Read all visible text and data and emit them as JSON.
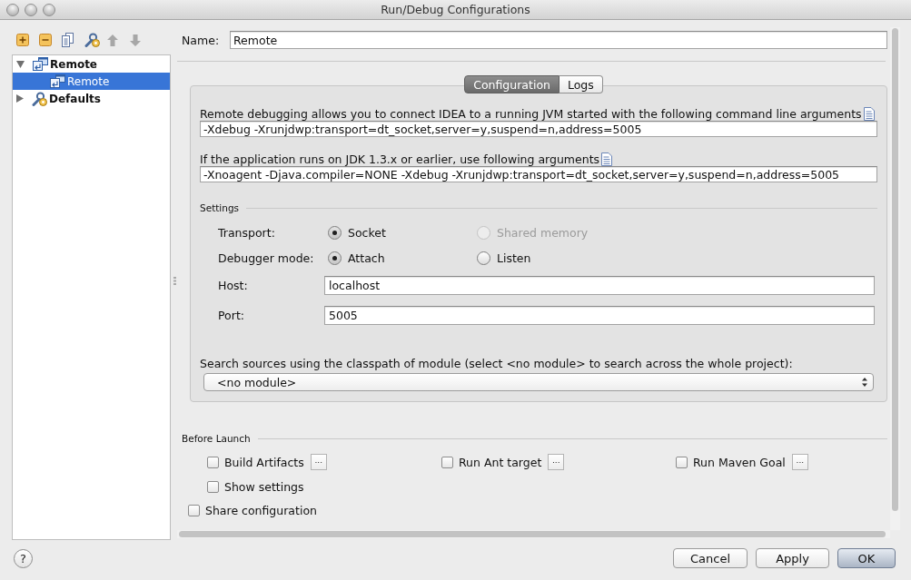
{
  "window": {
    "title": "Run/Debug Configurations"
  },
  "toolbar": [
    {
      "kind": "add",
      "disabled": false
    },
    {
      "kind": "remove",
      "disabled": false
    },
    {
      "kind": "copy",
      "disabled": false
    },
    {
      "kind": "defaults",
      "disabled": false
    },
    {
      "kind": "move-up",
      "disabled": true
    },
    {
      "kind": "move-down",
      "disabled": true
    }
  ],
  "tree": [
    {
      "kind": "remote",
      "label": "Remote",
      "expanded": true,
      "selected": false,
      "children": [
        {
          "kind": "remote",
          "label": "Remote",
          "selected": true
        }
      ]
    },
    {
      "kind": "defaults",
      "label": "Defaults",
      "expanded": false,
      "selected": false
    }
  ],
  "name_field": {
    "label": "Name:",
    "value": "Remote"
  },
  "tabs": [
    {
      "label": "Configuration",
      "selected": true
    },
    {
      "label": "Logs",
      "selected": false
    }
  ],
  "configuration": {
    "intro": "Remote debugging allows you to connect IDEA to a running JVM started with the following command line arguments",
    "command_line": "-Xdebug -Xrunjdwp:transport=dt_socket,server=y,suspend=n,address=5005",
    "legacy_intro": "If the application runs on JDK 1.3.x or earlier, use following arguments",
    "legacy_command_line": "-Xnoagent -Djava.compiler=NONE -Xdebug -Xrunjdwp:transport=dt_socket,server=y,suspend=n,address=5005",
    "settings": {
      "title": "Settings",
      "transport": {
        "label": "Transport:",
        "options": [
          {
            "label": "Socket",
            "selected": true,
            "disabled": false
          },
          {
            "label": "Shared memory",
            "selected": false,
            "disabled": true
          }
        ]
      },
      "debugger_mode": {
        "label": "Debugger mode:",
        "options": [
          {
            "label": "Attach",
            "selected": true,
            "disabled": false
          },
          {
            "label": "Listen",
            "selected": false,
            "disabled": false
          }
        ]
      },
      "host": {
        "label": "Host:",
        "value": "localhost"
      },
      "port": {
        "label": "Port:",
        "value": "5005"
      }
    },
    "module": {
      "label": "Search sources using the classpath of module (select <no module> to search across the whole project):",
      "value": "<no module>"
    }
  },
  "before_launch": {
    "title": "Before Launch",
    "options": [
      {
        "label": "Build Artifacts",
        "checked": false,
        "browse": "..."
      },
      {
        "label": "Run Ant target",
        "checked": false,
        "browse": "..."
      },
      {
        "label": "Run Maven Goal",
        "checked": false,
        "browse": "..."
      },
      {
        "label": "Show settings",
        "checked": false
      }
    ]
  },
  "share_configuration": {
    "label": "Share configuration",
    "checked": false
  },
  "help": "?",
  "buttons": [
    {
      "label": "Cancel",
      "default": false
    },
    {
      "label": "Apply",
      "default": false
    },
    {
      "label": "OK",
      "default": true
    }
  ]
}
